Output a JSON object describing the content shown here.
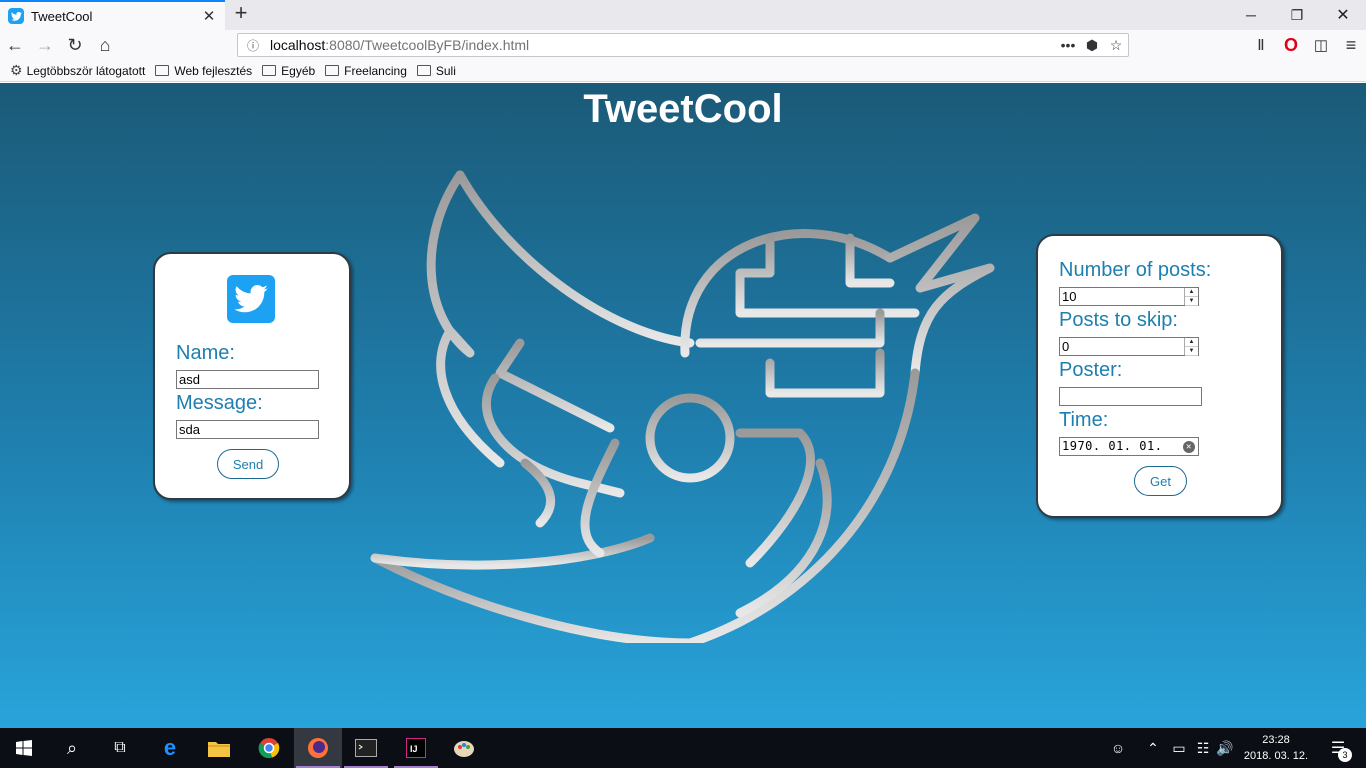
{
  "browser": {
    "tab_title": "TweetCool",
    "tab_close": "✕",
    "new_tab": "+",
    "url_host": "localhost",
    "url_rest": ":8080/TweetcoolByFB/index.html",
    "page_actions": "•••",
    "bookmarks": [
      {
        "label": "Legtöbbször látogatott",
        "icon": "gear-icon"
      },
      {
        "label": "Web fejlesztés",
        "icon": "folder-icon"
      },
      {
        "label": "Egyéb",
        "icon": "folder-icon"
      },
      {
        "label": "Freelancing",
        "icon": "folder-icon"
      },
      {
        "label": "Suli",
        "icon": "folder-icon"
      }
    ]
  },
  "page": {
    "title": "TweetCool",
    "post_form": {
      "name_label": "Name:",
      "name_value": "asd",
      "message_label": "Message:",
      "message_value": "sda",
      "send_button": "Send"
    },
    "filter_form": {
      "num_posts_label": "Number of posts:",
      "num_posts_value": "10",
      "skip_label": "Posts to skip:",
      "skip_value": "0",
      "poster_label": "Poster:",
      "poster_value": "",
      "time_label": "Time:",
      "time_value": "1970. 01. 01.",
      "get_button": "Get"
    }
  },
  "taskbar": {
    "time": "23:28",
    "date": "2018. 03. 12.",
    "notifications_count": "3",
    "apps": [
      "windows-start-icon",
      "search-icon",
      "task-view-icon",
      "edge-icon",
      "file-explorer-icon",
      "chrome-icon",
      "firefox-icon",
      "terminal-icon",
      "intellij-icon",
      "paint-icon"
    ]
  },
  "colors": {
    "accent": "#1e7fb0",
    "twitter_blue": "#1da1f2",
    "page_gradient_top": "#1b5a78",
    "page_gradient_bottom": "#28a4db"
  }
}
